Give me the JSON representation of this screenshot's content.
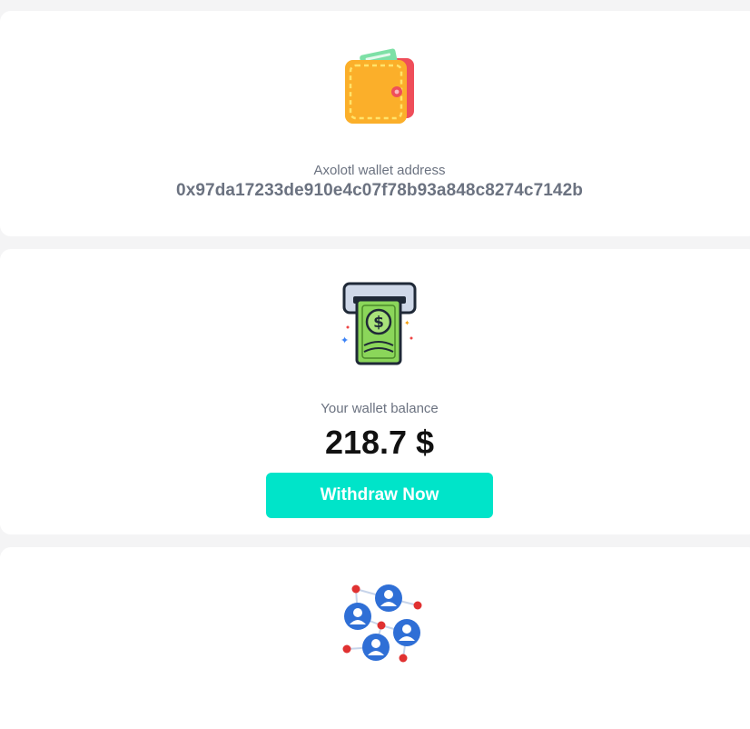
{
  "wallet_card": {
    "icon": "wallet-icon",
    "label": "Axolotl wallet address",
    "address": "0x97da17233de910e4c07f78b93a848c8274c7142b"
  },
  "balance_card": {
    "icon": "atm-cash-icon",
    "label": "Your wallet balance",
    "balance": "218.7 $",
    "withdraw_label": "Withdraw Now",
    "button_color": "#00e4c9"
  },
  "network_card": {
    "icon": "referral-network-icon"
  }
}
